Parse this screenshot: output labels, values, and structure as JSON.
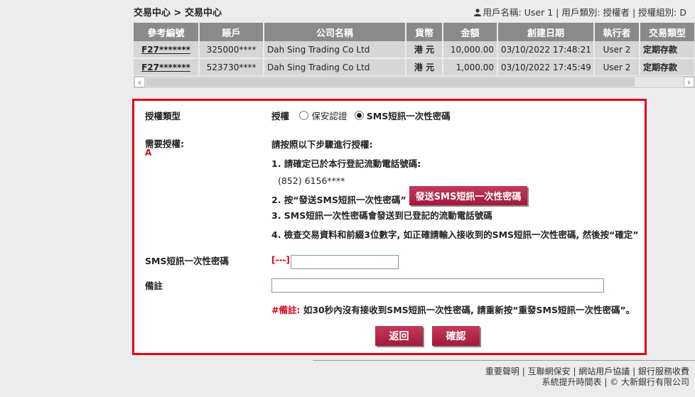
{
  "breadcrumb": "交易中心 > 交易中心",
  "user_info": {
    "name_label": "用戶名稱: User 1",
    "type_label": "| 用戶類別: 授權者",
    "group_label": "| 授權組別: D"
  },
  "table": {
    "headers": [
      "參考編號",
      "賬戶",
      "公司名稱",
      "貨幣",
      "金額",
      "創建日期",
      "執行者",
      "交易類型"
    ],
    "rows": [
      [
        "F27*******",
        "325000****",
        "Dah Sing Trading Co Ltd",
        "港 元",
        "10,000.00",
        "03/10/2022 17:48:21",
        "User 2",
        "定期存款"
      ],
      [
        "F27*******",
        "523730****",
        "Dah Sing Trading Co Ltd",
        "港 元",
        "1,000.00",
        "03/10/2022 17:45:49",
        "User 2",
        "定期存款"
      ]
    ]
  },
  "auth": {
    "type_label": "授權類型",
    "type_prefix": "授權",
    "option_token": "保安認證",
    "option_sms": "SMS短訊一次性密碼",
    "required_label": "需要授權:",
    "required_value": "A",
    "intro": "請按照以下步驟進行授權:",
    "step1": "1. 請確定已於本行登記流動電話號碼:",
    "phone": "(852) 6156****",
    "step2": "2. 按“發送SMS短訊一次性密碼”",
    "send_button": "發送SMS短訊一次性密碼",
    "step3": "3. SMS短訊一次性密碼會發送到已登記的流動電話號碼",
    "step4": "4. 檢查交易資料和前綴3位數字, 如正確請輸入接收到的SMS短訊一次性密碼, 然後按“確定”",
    "otp_label": "SMS短訊一次性密碼",
    "otp_prefix": "[---]",
    "remark_label": "備註",
    "note_label": "#備註:",
    "note_text": "如30秒內沒有接收到SMS短訊一次性密碼, 請重新按“重發SMS短訊一次性密碼”。",
    "back_button": "返回",
    "confirm_button": "確認"
  },
  "footer": {
    "links": [
      "重要聲明",
      "互聯網保安",
      "網站用戶協議",
      "銀行服務收費"
    ],
    "line2_link": "系統提升時間表",
    "copyright": "| © 大新銀行有限公司"
  },
  "colors": {
    "accent_red": "#e3001b",
    "button_red": "#b0244a",
    "table_header": "#8a8a8a"
  }
}
